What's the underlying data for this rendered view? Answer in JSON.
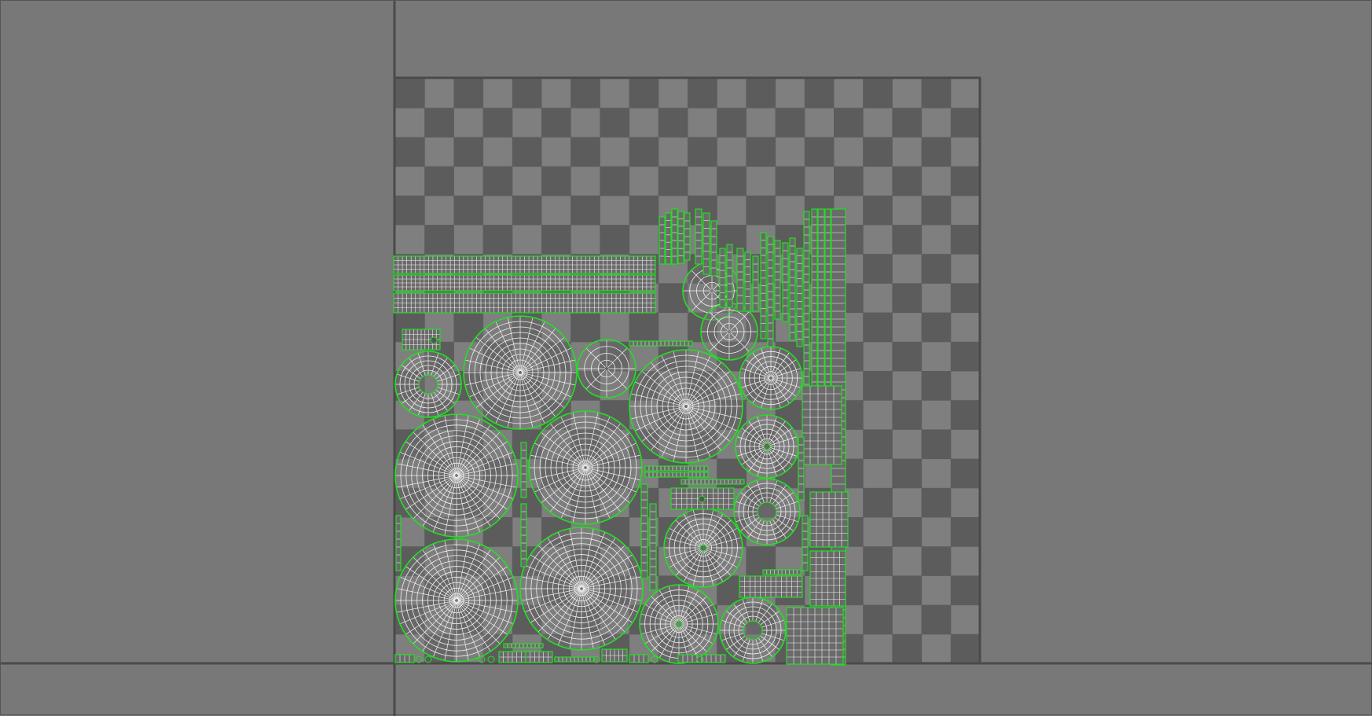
{
  "window": {
    "title": ""
  },
  "editor": {
    "view": "uv-editor",
    "background_color": "#787878",
    "axis_color": "#4a4a4a",
    "checker": {
      "light": "#7f7f7f",
      "dark": "#5c5c5c",
      "tiles": 20
    },
    "uv_edge_color": "#f2f2f2",
    "uv_border_color": "#22e022",
    "shell_types": [
      "disc",
      "strip",
      "block"
    ]
  }
}
